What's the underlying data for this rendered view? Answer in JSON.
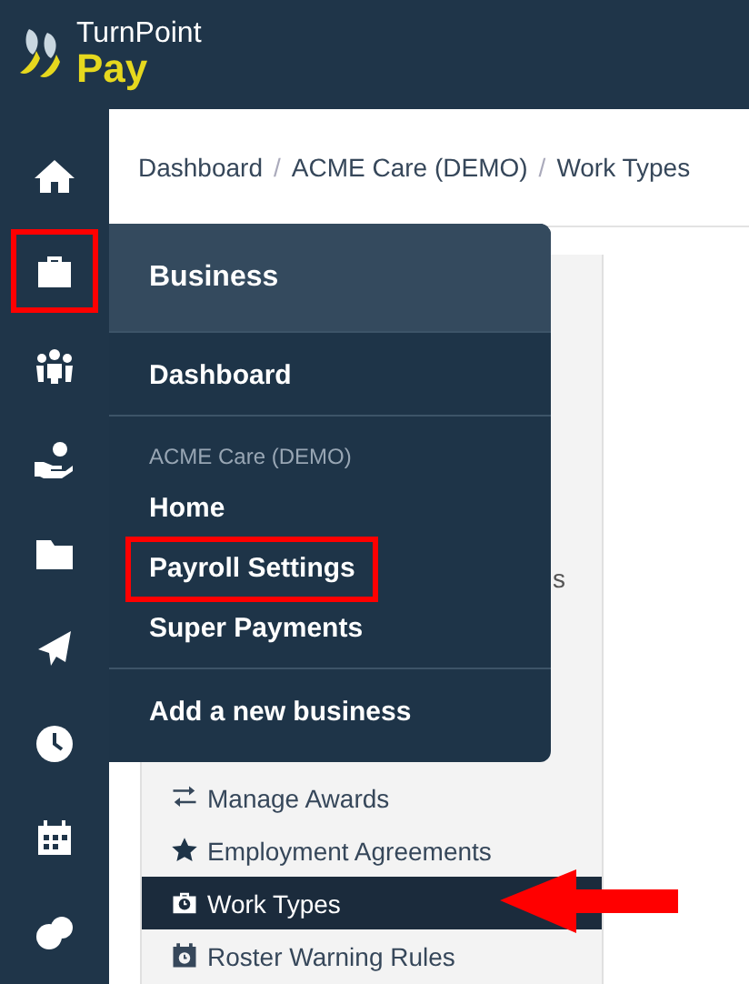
{
  "header": {
    "logo_top": "TurnPoint",
    "logo_bottom": "Pay"
  },
  "rail": [
    {
      "kind": "home",
      "highlighted": false
    },
    {
      "kind": "briefcase",
      "highlighted": true
    },
    {
      "kind": "people",
      "highlighted": false
    },
    {
      "kind": "hand",
      "highlighted": false
    },
    {
      "kind": "folder",
      "highlighted": false
    },
    {
      "kind": "plane",
      "highlighted": false
    },
    {
      "kind": "clock",
      "highlighted": false
    },
    {
      "kind": "calendar",
      "highlighted": false
    },
    {
      "kind": "coins",
      "highlighted": false
    }
  ],
  "breadcrumb": [
    {
      "label": "Dashboard",
      "separator": "/"
    },
    {
      "label": "ACME Care (DEMO)",
      "separator": "/"
    },
    {
      "label": "Work Types"
    }
  ],
  "menu": {
    "title": "Business",
    "sections": [
      {
        "items": [
          {
            "label": "Dashboard",
            "highlighted": false
          }
        ]
      },
      {
        "heading": "ACME Care (DEMO)",
        "items": [
          {
            "label": "Home",
            "highlighted": false
          },
          {
            "label": "Payroll Settings",
            "highlighted": true
          },
          {
            "label": "Super Payments",
            "highlighted": false
          }
        ]
      },
      {
        "items": [
          {
            "label": "Add a new business",
            "highlighted": false
          }
        ]
      }
    ]
  },
  "settings_nav": {
    "hidden_fragment": "s",
    "items": [
      {
        "kind": "swap",
        "label": "Manage Awards",
        "selected": false,
        "pointed": false
      },
      {
        "kind": "star",
        "label": "Employment Agreements",
        "selected": false,
        "pointed": false
      },
      {
        "kind": "worktype",
        "label": "Work Types",
        "selected": true,
        "pointed": true
      },
      {
        "kind": "roster",
        "label": "Roster Warning Rules",
        "selected": false,
        "pointed": false
      }
    ]
  }
}
